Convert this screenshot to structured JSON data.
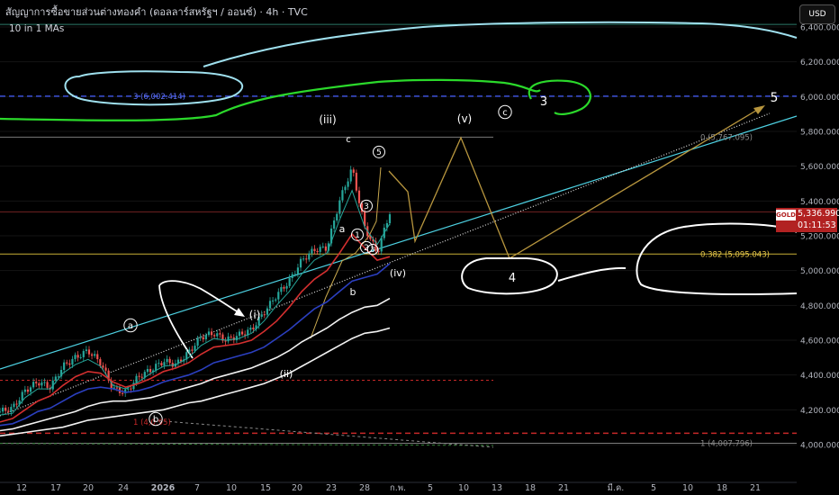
{
  "header": {
    "title": "สัญญาการซื้อขายส่วนต่างทองคำ (ดอลลาร์สหรัฐฯ / ออนซ์) · 4h · TVC",
    "indicator": "10 in 1 MAs",
    "currency_button": "USD"
  },
  "price_tag": {
    "symbol": "GOLD",
    "price": "5,336.990",
    "countdown": "01:11:53"
  },
  "colors": {
    "background": "#000000",
    "candle_up": "#26a69a",
    "candle_down": "#ef5350",
    "fib": "#c9b037",
    "wave": "#b8963e"
  },
  "chart_data": {
    "type": "candlestick",
    "y_axis": {
      "range": [
        3920,
        6470
      ],
      "ticks": [
        "4,000.000",
        "4,200.000",
        "4,400.000",
        "4,600.000",
        "4,800.000",
        "5,000.000",
        "5,200.000",
        "5,400.000",
        "5,600.000",
        "5,800.000",
        "6,000.000",
        "6,200.000",
        "6,400.000"
      ]
    },
    "x_axis": {
      "ticks": [
        "12",
        "17",
        "20",
        "24",
        "2026",
        "7",
        "10",
        "15",
        "20",
        "23",
        "28",
        "ก.พ.",
        "5",
        "10",
        "13",
        "18",
        "21",
        "มี.ค.",
        "5",
        "10",
        "18",
        "21"
      ]
    },
    "series": [
      {
        "values": [
          4190,
          4210,
          4310,
          4360,
          4330,
          4450,
          4500,
          4540,
          4470,
          4320,
          4300,
          4390,
          4430,
          4480,
          4460,
          4530,
          4620,
          4640,
          4600,
          4630,
          4660,
          4760,
          4860,
          4940,
          5060,
          5120,
          5130,
          5400,
          5590,
          5250,
          5100,
          5336
        ]
      },
      {
        "values": [
          4170,
          4180,
          4270,
          4320,
          4320,
          4410,
          4460,
          4490,
          4450,
          4340,
          4320,
          4360,
          4410,
          4450,
          4460,
          4500,
          4570,
          4610,
          4600,
          4610,
          4640,
          4710,
          4800,
          4880,
          4980,
          5060,
          5100,
          5290,
          5460,
          5250,
          5150,
          5270
        ]
      },
      {
        "values": [
          4130,
          4150,
          4200,
          4250,
          4280,
          4340,
          4390,
          4420,
          4410,
          4360,
          4330,
          4350,
          4380,
          4420,
          4440,
          4470,
          4520,
          4560,
          4570,
          4580,
          4600,
          4650,
          4710,
          4790,
          4880,
          4950,
          5000,
          5100,
          5210,
          5130,
          5060,
          5080
        ]
      },
      {
        "values": [
          4110,
          4120,
          4150,
          4190,
          4210,
          4250,
          4290,
          4320,
          4330,
          4320,
          4300,
          4310,
          4330,
          4360,
          4380,
          4400,
          4430,
          4470,
          4490,
          4510,
          4530,
          4560,
          4610,
          4660,
          4720,
          4780,
          4820,
          4880,
          4940,
          4960,
          4980,
          5040
        ]
      },
      {
        "values": [
          4080,
          4090,
          4110,
          4130,
          4150,
          4170,
          4190,
          4220,
          4240,
          4250,
          4250,
          4260,
          4270,
          4290,
          4310,
          4330,
          4350,
          4380,
          4400,
          4420,
          4440,
          4470,
          4500,
          4540,
          4590,
          4630,
          4670,
          4720,
          4760,
          4790,
          4800,
          4840
        ]
      },
      {
        "values": [
          4050,
          4060,
          4070,
          4080,
          4090,
          4100,
          4120,
          4140,
          4150,
          4160,
          4170,
          4180,
          4190,
          4200,
          4220,
          4240,
          4250,
          4270,
          4290,
          4310,
          4330,
          4350,
          4380,
          4410,
          4450,
          4490,
          4530,
          4570,
          4610,
          4640,
          4650,
          4670
        ]
      }
    ],
    "levels": [
      {
        "label": "0 (5,767.095)",
        "value": 5767.095
      },
      {
        "label": "0.382 (5,095.043)",
        "value": 5095.043
      },
      {
        "label": "1 (4,007.796)",
        "value": 4007.796
      },
      {
        "label": "3 (6,002.414)",
        "value": 6002.414
      },
      {
        "label": "1 (4,0.95)",
        "value": 4130
      }
    ],
    "annotations": [
      "(iii)",
      "(v)",
      "c",
      "3",
      "5",
      "c",
      "5",
      "3",
      "a",
      "1",
      "2",
      "b",
      "3",
      "(iv)",
      "4",
      "(i)",
      "a",
      "(ii)",
      "b"
    ]
  }
}
